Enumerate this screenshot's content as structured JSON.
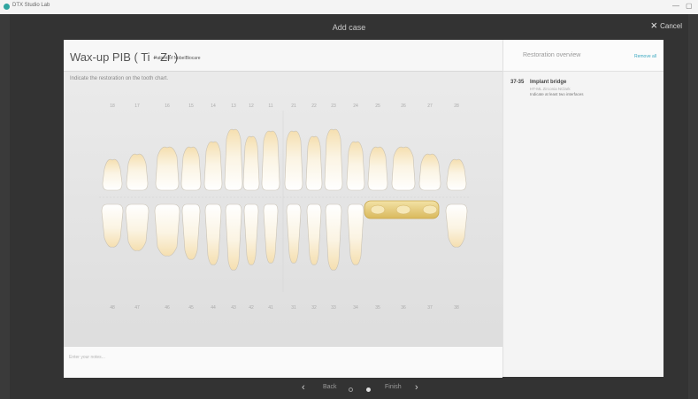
{
  "titlebar": {
    "app_name": "DTX Studio Lab",
    "minimize": "—",
    "maximize": "▢",
    "logo_color": "#2fa5a0"
  },
  "header": {
    "title": "Add case",
    "cancel_label": "Cancel",
    "cancel_icon": "close-icon"
  },
  "case": {
    "title": "Wax-up PIB ( Ti - Zr )",
    "subtitle": "Patient of NobelBiocare"
  },
  "instruction": "Indicate the restoration on the tooth chart.",
  "upper_numbers": [
    "18",
    "17",
    "16",
    "15",
    "14",
    "13",
    "12",
    "11",
    "21",
    "22",
    "23",
    "24",
    "25",
    "26",
    "27",
    "28"
  ],
  "lower_numbers": [
    "48",
    "47",
    "46",
    "45",
    "44",
    "43",
    "42",
    "41",
    "31",
    "32",
    "33",
    "34",
    "35",
    "36",
    "37",
    "38"
  ],
  "notes_placeholder": "Enter your notes...",
  "overview": {
    "title": "Restoration overview",
    "remove_all": "Remove all",
    "entries": [
      {
        "range": "37-35",
        "type": "Implant bridge",
        "material": "HT-ML Zirconia NClark",
        "note": "Indicate at least two interfaces"
      }
    ]
  },
  "footer": {
    "back": "Back",
    "finish": "Finish",
    "current_step": 2,
    "total_steps": 2
  },
  "colors": {
    "accent": "#3aa8c0",
    "selected_tooth": "#e8cf82",
    "tooth": "#ffffff"
  }
}
